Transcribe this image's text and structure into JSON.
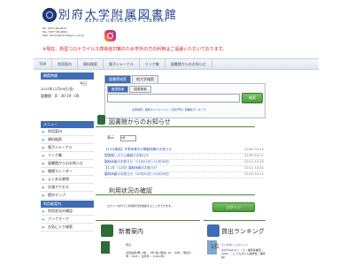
{
  "header": {
    "title_ja": "別府大学附属図書館",
    "title_en": "BEPPU UNIVERSITY LIBRARY",
    "tel": "Tel. 0977-66-9633",
    "fax": "Fax. 0977-66-9632",
    "mail": "Mail. library@nm.beppu-u.ac.jp",
    "notice": "※現在、新型コロナウイルス感染症対策のため学外の方の利用はご遠慮いただいております。"
  },
  "topnav": [
    "TOP",
    "利用案内",
    "資料検索",
    "電子ジャーナル",
    "リンク集",
    "図書館からのお知らせ"
  ],
  "opening": {
    "header": "開館時間",
    "today_label": "今日",
    "date": "2022年12月09日(金)",
    "library_label": "図書館",
    "hours": "8：30-19：00"
  },
  "menu": {
    "header": "メニュー",
    "items": [
      "利用案内",
      "資料検索",
      "電子ジャーナル",
      "リンク集",
      "図書館からのお知らせ",
      "開館カレンダー",
      "よくある質問",
      "交通アクセス",
      "館内マップ"
    ]
  },
  "user_guide": {
    "header": "利用者案内",
    "items": [
      "利用状況の確認",
      "ブックマーク",
      "お気に入り検索"
    ]
  },
  "search": {
    "tabs": [
      "図書館検索",
      "他大学検索"
    ],
    "subtabs": [
      "蔵書検索",
      "図書検索"
    ],
    "button": "検索",
    "links": "全体検索 | 雑誌タイトルリスト | 貸出予約 | 図書館ランキング"
  },
  "news": {
    "title": "図書館からのお知らせ",
    "count_label": "表示",
    "count_value": "5件",
    "items": [
      {
        "title": "【12/8更新】冬季休業中の開館時間のお知らせ",
        "date": "22/09 10:10"
      },
      {
        "title": "図書館システム機能のお知らせ",
        "date": "22/09 10:11"
      },
      {
        "title": "臨時休館のお知らせ（11月21日～12月18日）",
        "date": "22/11 14:35"
      },
      {
        "title": "【11月・12月】臨時休館のお知らせ",
        "date": "22/11 14:31"
      },
      {
        "title": "臨時休館のお知らせ（10月20日～10月18日）",
        "date": "22/10 10:11"
      }
    ]
  },
  "usage": {
    "title": "利用状況の確認",
    "text": "ログインを行うと利用状況を確認することができます。",
    "button": "ログイン"
  },
  "new_books": {
    "title": "新着案内",
    "item_title": "明道",
    "item_detail": "太田由彦(著) 3版 -- 7年1版 (明治) 16 -- 文学。 明治大学、1995 -- 全年年 -- [1910年]"
  },
  "ranking": {
    "title": "貸出ランキング",
    "rank": "1位",
    "item_title": "そらまめくんのベッド",
    "item_detail": "なかやみわさく・え / 福音館書店 / 1999. -- (こどものとも傑作集 / 福音館)"
  }
}
